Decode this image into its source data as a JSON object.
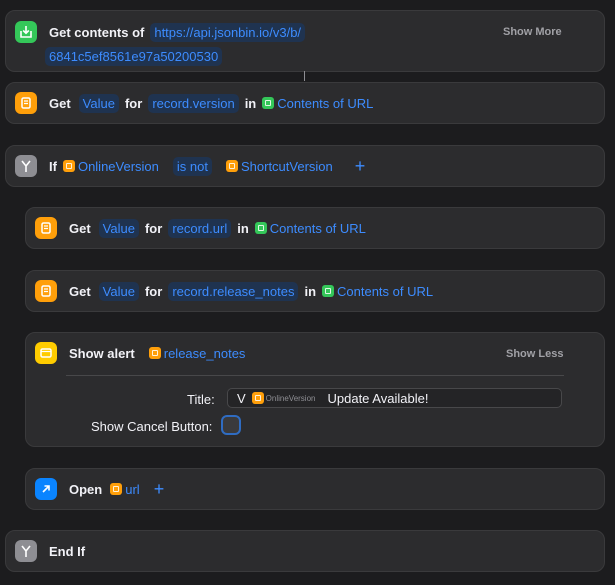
{
  "blocks": {
    "get_contents": {
      "label": "Get contents of",
      "url_line1": "https://api.jsonbin.io/v3/b/",
      "url_line2": "6841c5ef8561e97a50200530",
      "show_more": "Show More"
    },
    "get_version": {
      "get": "Get",
      "value": "Value",
      "for": "for",
      "key": "record.version",
      "in": "in",
      "source": "Contents of URL"
    },
    "if_block": {
      "if": "If",
      "left": "OnlineVersion",
      "cond": "is not",
      "right": "ShortcutVersion",
      "add": "+"
    },
    "get_url": {
      "get": "Get",
      "value": "Value",
      "for": "for",
      "key": "record.url",
      "in": "in",
      "source": "Contents of URL"
    },
    "get_notes": {
      "get": "Get",
      "value": "Value",
      "for": "for",
      "key": "record.release_notes",
      "in": "in",
      "source": "Contents of URL"
    },
    "show_alert": {
      "label": "Show alert",
      "var": "release_notes",
      "show_less": "Show Less",
      "title_label": "Title:",
      "title_prefix": "V",
      "title_var": "OnlineVersion",
      "title_suffix": "Update Available!",
      "cancel_label": "Show Cancel Button:"
    },
    "open": {
      "label": "Open",
      "var": "url",
      "add": "+"
    },
    "end_if": {
      "label": "End If"
    }
  },
  "colors": {
    "background": "#1c1c1e",
    "card": "#2c2c2e",
    "accent_blue": "#3d8cff",
    "green_icon": "#34c759",
    "orange_icon": "#ff9f0a",
    "yellow_icon": "#ffcc00",
    "gray_icon": "#8e8e93",
    "blue_icon": "#0a84ff"
  },
  "icons": {
    "get_contents": "download-icon",
    "get_value": "dictionary-icon",
    "if": "branch-icon",
    "show_alert": "alert-icon",
    "open": "open-link-icon",
    "end_if": "branch-icon"
  }
}
